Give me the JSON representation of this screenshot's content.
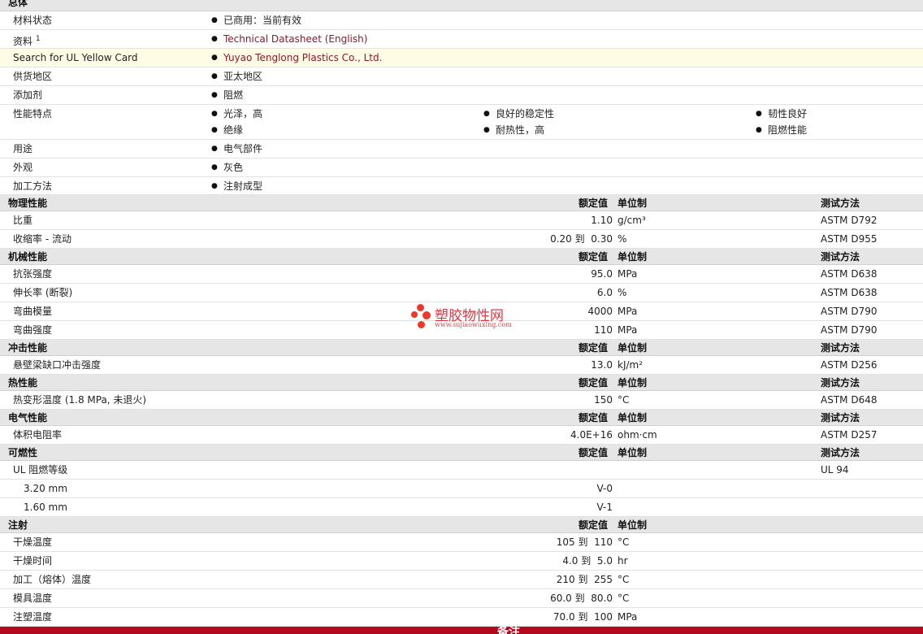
{
  "general": {
    "title": "总体",
    "rows": [
      {
        "label": "材料状态",
        "values": [
          "已商用：当前有效"
        ]
      },
      {
        "label": "资料",
        "sup": "1",
        "values": [
          "Technical Datasheet (English)"
        ]
      },
      {
        "label": "Search for UL Yellow Card",
        "values": [
          "Yuyao Tenglong Plastics Co., Ltd."
        ]
      },
      {
        "label": "供货地区",
        "values": [
          "亚太地区"
        ]
      },
      {
        "label": "添加剂",
        "values": [
          "阻燃"
        ]
      },
      {
        "label": "性能特点",
        "values": [
          "光泽，高",
          "绝缘",
          "良好的稳定性",
          "耐热性，高",
          "韧性良好",
          "阻燃性能"
        ]
      },
      {
        "label": "用途",
        "values": [
          "电气部件"
        ]
      },
      {
        "label": "外观",
        "values": [
          "灰色"
        ]
      },
      {
        "label": "加工方法",
        "values": [
          "注射成型"
        ]
      }
    ]
  },
  "headers": {
    "nominal": "额定值",
    "unit": "单位制",
    "method": "测试方法"
  },
  "sections": {
    "physical": {
      "title": "物理性能",
      "rows": [
        {
          "label": "比重",
          "value": "1.10",
          "unit": "g/cm³",
          "method": "ASTM D792"
        },
        {
          "label": "收缩率 - 流动",
          "value_from": "0.20",
          "range_word": "到",
          "value": "0.30",
          "unit": "%",
          "method": "ASTM D955"
        }
      ]
    },
    "mechanical": {
      "title": "机械性能",
      "rows": [
        {
          "label": "抗张强度",
          "value": "95.0",
          "unit": "MPa",
          "method": "ASTM D638"
        },
        {
          "label": "伸长率 (断裂)",
          "value": "6.0",
          "unit": "%",
          "method": "ASTM D638"
        },
        {
          "label": "弯曲模量",
          "value": "4000",
          "unit": "MPa",
          "method": "ASTM D790"
        },
        {
          "label": "弯曲强度",
          "value": "110",
          "unit": "MPa",
          "method": "ASTM D790"
        }
      ]
    },
    "impact": {
      "title": "冲击性能",
      "rows": [
        {
          "label": "悬壁梁缺口冲击强度",
          "value": "13.0",
          "unit": "kJ/m²",
          "method": "ASTM D256"
        }
      ]
    },
    "thermal": {
      "title": "热性能",
      "rows": [
        {
          "label": "热变形温度 (1.8 MPa, 未退火)",
          "value": "150",
          "unit": "°C",
          "method": "ASTM D648"
        }
      ]
    },
    "electrical": {
      "title": "电气性能",
      "rows": [
        {
          "label": "体积电阻率",
          "value": "4.0E+16",
          "unit": "ohm·cm",
          "method": "ASTM D257"
        }
      ]
    },
    "flammability": {
      "title": "可燃性",
      "rows": [
        {
          "label": "UL 阻燃等级",
          "method": "UL 94"
        },
        {
          "label": "3.20 mm",
          "value": "V-0"
        },
        {
          "label": "1.60 mm",
          "value": "V-1"
        }
      ]
    },
    "injection": {
      "title": "注射",
      "rows": [
        {
          "label": "干燥温度",
          "value_from": "105",
          "range_word": "到",
          "value": "110",
          "unit": "°C"
        },
        {
          "label": "干燥时间",
          "value_from": "4.0",
          "range_word": "到",
          "value": "5.0",
          "unit": "hr"
        },
        {
          "label": "加工（熔体）温度",
          "value_from": "210",
          "range_word": "到",
          "value": "255",
          "unit": "°C"
        },
        {
          "label": "模具温度",
          "value_from": "60.0",
          "range_word": "到",
          "value": "80.0",
          "unit": "°C"
        },
        {
          "label": "注塑温度",
          "value_from": "70.0",
          "range_word": "到",
          "value": "100",
          "unit": "MPa"
        }
      ]
    }
  },
  "footer": {
    "title": "备注"
  },
  "watermark": {
    "name": "塑胶物性网",
    "url": "www.sujiaowuxing.com",
    "color": "#e3202c"
  }
}
